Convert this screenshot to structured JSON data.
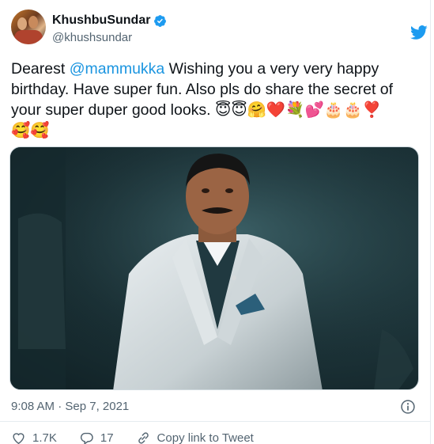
{
  "user": {
    "display_name": "KhushbuSundar",
    "handle": "@khushsundar",
    "verified": true
  },
  "tweet": {
    "text_before": "Dearest ",
    "mention": "@mammukka",
    "text_after": " Wishing you a very very happy birthday. Have super fun. Also pls do share the secret of your super duper good looks. ",
    "emoji_line1": "😇😇🤗❤️💐💕🎂🎂❣️",
    "emoji_line2": "🥰🥰",
    "timestamp": "9:08 AM · Sep 7, 2021"
  },
  "actions": {
    "likes": "1.7K",
    "replies": "17",
    "copy_link": "Copy link to Tweet"
  },
  "colors": {
    "brand_blue": "#1d9bf0",
    "mention": "#1b95e0",
    "secondary_text": "#536471",
    "like_icon": "#e0245e"
  },
  "icons": {
    "verified": "verified-badge-icon",
    "logo": "twitter-bird-icon",
    "info": "info-icon",
    "like": "heart-icon",
    "reply": "reply-bubble-icon",
    "link": "link-icon"
  }
}
